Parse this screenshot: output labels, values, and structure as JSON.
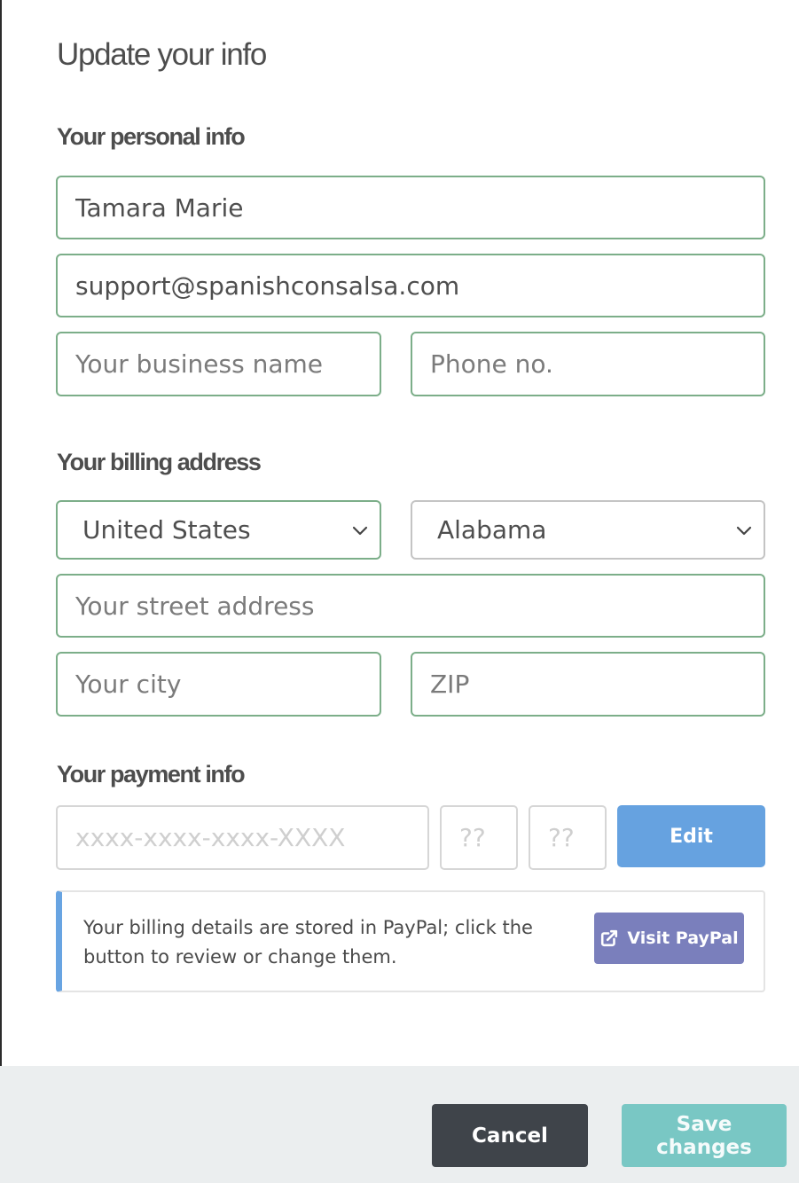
{
  "dialog": {
    "title": "Update your info"
  },
  "personal": {
    "heading": "Your personal info",
    "name_value": "Tamara Marie",
    "email_value": "support@spanishconsalsa.com",
    "business_placeholder": "Your business name",
    "phone_placeholder": "Phone no."
  },
  "billing": {
    "heading": "Your billing address",
    "country": "United States",
    "state": "Alabama",
    "street_placeholder": "Your street address",
    "city_placeholder": "Your city",
    "zip_placeholder": "ZIP"
  },
  "payment": {
    "heading": "Your payment info",
    "card_placeholder": "xxxx-xxxx-xxxx-XXXX",
    "month_placeholder": "??",
    "year_placeholder": "??",
    "edit_label": "Edit",
    "notice_text": "Your billing details are stored in PayPal; click the button to review or change them.",
    "paypal_label": "Visit PayPal",
    "paypal_icon": "external-link-icon"
  },
  "footer": {
    "cancel_label": "Cancel",
    "save_label": "Save changes"
  },
  "colors": {
    "field_border": "#7cae89",
    "edit_button": "#66a2e0",
    "paypal_button": "#7a7fbc",
    "cancel_button": "#3f444a",
    "save_button": "#79c7c4",
    "notice_accent": "#68a4e2",
    "footer_bg": "#ebeeef"
  }
}
